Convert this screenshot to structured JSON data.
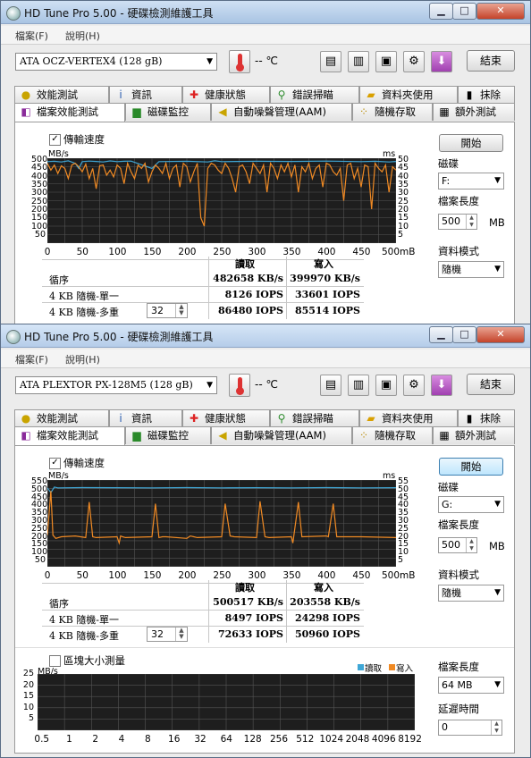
{
  "windows": [
    {
      "title": "HD Tune Pro 5.00 - 硬碟檢測維護工具",
      "menu": [
        "檔案(F)",
        "說明(H)"
      ],
      "drive": "ATA    OCZ-VERTEX4    (128 gB)",
      "temperature": "-- ℃",
      "exit_label": "結束",
      "tabs_top": [
        "效能測試",
        "資訊",
        "健康狀態",
        "錯誤掃瞄",
        "資料夾使用",
        "抹除"
      ],
      "tabs_bottom": [
        "檔案效能測試",
        "磁碟監控",
        "自動噪聲管理(AAM)",
        "隨機存取",
        "額外測試"
      ],
      "transfer_checkbox": "傳輸速度",
      "chart": {
        "left_unit": "MB/s",
        "right_unit": "ms",
        "y_ticks_left": [
          "500",
          "450",
          "400",
          "350",
          "300",
          "250",
          "200",
          "150",
          "100",
          "50"
        ],
        "y_ticks_right": [
          "50",
          "45",
          "40",
          "35",
          "30",
          "25",
          "20",
          "15",
          "10",
          "5"
        ],
        "x_ticks": [
          "0",
          "50",
          "100",
          "150",
          "200",
          "250",
          "300",
          "350",
          "400",
          "450",
          "500mB"
        ]
      },
      "results": {
        "col_read": "讀取",
        "col_write": "寫入",
        "rows": [
          {
            "label": "循序",
            "read": "482658 KB/s",
            "write": "399970 KB/s"
          },
          {
            "label": "4 KB 隨機-單一",
            "read": "8126 IOPS",
            "write": "33601 IOPS"
          },
          {
            "label": "4 KB 隨機-多重",
            "read": "86480 IOPS",
            "write": "85514 IOPS"
          }
        ],
        "queue_depth": "32"
      },
      "side": {
        "start_label": "開始",
        "drive_label": "磁碟",
        "drive_value": "F:",
        "file_length_label": "檔案長度",
        "file_length_value": "500",
        "file_length_unit": "MB",
        "data_mode_label": "資料模式",
        "data_mode_value": "隨機"
      },
      "chart_data": {
        "type": "line",
        "x_range": [
          0,
          500
        ],
        "x_unit": "MB",
        "ylim_left": [
          0,
          500
        ],
        "ylim_right": [
          0,
          50
        ],
        "series": [
          {
            "color": "#3fa7d6",
            "x": [
              0,
              10,
              20,
              30,
              40,
              45,
              50,
              60,
              70,
              80,
              90,
              100,
              110,
              120,
              150,
              160,
              200,
              230,
              240,
              250,
              300,
              350,
              400,
              450,
              470,
              490,
              500
            ],
            "values": [
              480,
              482,
              478,
              485,
              470,
              440,
              480,
              483,
              481,
              478,
              484,
              480,
              482,
              483,
              440,
              480,
              482,
              478,
              485,
              480,
              482,
              481,
              483,
              480,
              482,
              478,
              481
            ]
          },
          {
            "color": "#f08a24",
            "x": [
              0,
              5,
              10,
              15,
              20,
              25,
              30,
              35,
              40,
              45,
              50,
              55,
              60,
              65,
              70,
              75,
              80,
              85,
              90,
              95,
              100,
              105,
              110,
              115,
              120,
              125,
              130,
              135,
              140,
              145,
              150,
              155,
              160,
              165,
              170,
              175,
              180,
              185,
              190,
              195,
              200,
              205,
              210,
              215,
              220,
              225,
              230,
              235,
              240,
              245,
              250,
              255,
              260,
              265,
              270,
              275,
              280,
              285,
              290,
              295,
              300,
              305,
              310,
              315,
              320,
              325,
              330,
              335,
              340,
              345,
              350,
              355,
              360,
              365,
              370,
              375,
              380,
              385,
              390,
              395,
              400,
              405,
              410,
              415,
              420,
              425,
              430,
              435,
              440,
              445,
              450,
              455,
              460,
              465,
              470,
              475,
              480,
              485,
              490,
              495,
              500
            ],
            "values": [
              470,
              430,
              460,
              410,
              455,
              440,
              380,
              460,
              470,
              450,
              420,
              465,
              380,
              440,
              320,
              455,
              460,
              400,
              430,
              390,
              460,
              440,
              350,
              470,
              420,
              380,
              460,
              440,
              470,
              360,
              420,
              460,
              440,
              410,
              470,
              380,
              440,
              460,
              330,
              470,
              450,
              360,
              420,
              470,
              150,
              100,
              440,
              470,
              460,
              430,
              410,
              470,
              440,
              380,
              300,
              450,
              460,
              420,
              350,
              470,
              440,
              410,
              460,
              300,
              470,
              440,
              380,
              460,
              420,
              470,
              390,
              460,
              300,
              450,
              420,
              470,
              380,
              440,
              460,
              330,
              470,
              460,
              420,
              400,
              440,
              250,
              460,
              470,
              380,
              440,
              330,
              460,
              450,
              200,
              470,
              440,
              420,
              460,
              300,
              450,
              430
            ]
          }
        ]
      }
    },
    {
      "title": "HD Tune Pro 5.00 - 硬碟檢測維護工具",
      "menu": [
        "檔案(F)",
        "說明(H)"
      ],
      "drive": "ATA    PLEXTOR PX-128M5 (128 gB)",
      "temperature": "-- ℃",
      "exit_label": "結束",
      "tabs_top": [
        "效能測試",
        "資訊",
        "健康狀態",
        "錯誤掃瞄",
        "資料夾使用",
        "抹除"
      ],
      "tabs_bottom": [
        "檔案效能測試",
        "磁碟監控",
        "自動噪聲管理(AAM)",
        "隨機存取",
        "額外測試"
      ],
      "transfer_checkbox": "傳輸速度",
      "chart": {
        "left_unit": "MB/s",
        "right_unit": "ms",
        "y_ticks_left": [
          "550",
          "500",
          "450",
          "400",
          "350",
          "300",
          "250",
          "200",
          "150",
          "100",
          "50"
        ],
        "y_ticks_right": [
          "55",
          "50",
          "45",
          "40",
          "35",
          "30",
          "25",
          "20",
          "15",
          "10",
          "5"
        ],
        "x_ticks": [
          "0",
          "50",
          "100",
          "150",
          "200",
          "250",
          "300",
          "350",
          "400",
          "450",
          "500mB"
        ]
      },
      "results": {
        "col_read": "讀取",
        "col_write": "寫入",
        "rows": [
          {
            "label": "循序",
            "read": "500517 KB/s",
            "write": "203558 KB/s"
          },
          {
            "label": "4 KB 隨機-單一",
            "read": "8497 IOPS",
            "write": "24298 IOPS"
          },
          {
            "label": "4 KB 隨機-多重",
            "read": "72633 IOPS",
            "write": "50960 IOPS"
          }
        ],
        "queue_depth": "32"
      },
      "side": {
        "start_label": "開始",
        "drive_label": "磁碟",
        "drive_value": "G:",
        "file_length_label": "檔案長度",
        "file_length_value": "500",
        "file_length_unit": "MB",
        "data_mode_label": "資料模式",
        "data_mode_value": "隨機"
      },
      "block": {
        "checkbox": "區塊大小測量",
        "unit": "MB/s",
        "legend_read": "讀取",
        "legend_write": "寫入",
        "y_ticks": [
          "25",
          "20",
          "15",
          "10",
          "5"
        ],
        "x_ticks": [
          "0.5",
          "1",
          "2",
          "4",
          "8",
          "16",
          "32",
          "64",
          "128",
          "256",
          "512",
          "1024",
          "2048",
          "4096",
          "8192"
        ],
        "file_length_label": "檔案長度",
        "file_length_value": "64 MB",
        "delay_label": "延遲時間",
        "delay_value": "0"
      },
      "chart_data": {
        "type": "line",
        "x_range": [
          0,
          500
        ],
        "x_unit": "MB",
        "ylim_left": [
          0,
          550
        ],
        "ylim_right": [
          0,
          55
        ],
        "series": [
          {
            "color": "#3fa7d6",
            "x": [
              0,
              5,
              10,
              15,
              50,
              100,
              150,
              200,
              250,
              300,
              350,
              400,
              450,
              500
            ],
            "values": [
              500,
              470,
              505,
              500,
              502,
              501,
              500,
              502,
              500,
              501,
              500,
              502,
              500,
              501
            ]
          },
          {
            "color": "#f08a24",
            "x": [
              0,
              5,
              8,
              12,
              20,
              40,
              55,
              60,
              65,
              70,
              100,
              103,
              105,
              108,
              112,
              150,
              155,
              160,
              165,
              170,
              200,
              205,
              210,
              215,
              250,
              255,
              262,
              268,
              300,
              305,
              312,
              318,
              350,
              352,
              360,
              365,
              400,
              403,
              410,
              415,
              450,
              500
            ],
            "values": [
              200,
              480,
              200,
              180,
              190,
              195,
              185,
              410,
              190,
              185,
              190,
              150,
              195,
              190,
              185,
              190,
              400,
              185,
              190,
              190,
              180,
              195,
              190,
              185,
              190,
              400,
              195,
              190,
              185,
              415,
              190,
              185,
              190,
              150,
              410,
              190,
              195,
              190,
              400,
              190,
              190,
              185
            ]
          }
        ]
      }
    }
  ]
}
